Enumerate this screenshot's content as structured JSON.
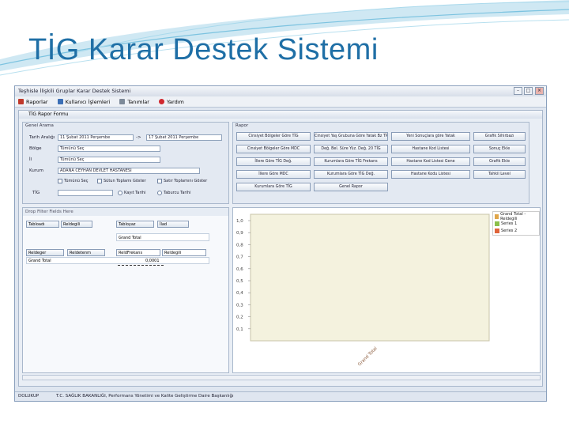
{
  "slide": {
    "title": "TİG Karar Destek Sistemi"
  },
  "window": {
    "title": "Teşhisle İlişkili Gruplar Karar Destek Sistemi",
    "menu": [
      {
        "label": "Raporlar",
        "icon": "report-icon",
        "color": "#c0392b"
      },
      {
        "label": "Kullanıcı İşlemleri",
        "icon": "users-icon",
        "color": "#3b6fb6"
      },
      {
        "label": "Tanımlar",
        "icon": "settings-icon",
        "color": "#7d8a99"
      },
      {
        "label": "Yardım",
        "icon": "heart-icon",
        "color": "#d0282f"
      }
    ]
  },
  "form": {
    "title": "TİG Rapor Formu",
    "filter_group": "Genel Arama",
    "date_label": "Tarih Aralığı",
    "date_from": "11  Şubat  2011 Perşembe",
    "date_sep": "->",
    "date_to": "17  Şubat  2011 Perşembe",
    "region_label": "Bölge",
    "region_value": "Tümünü Seç",
    "city_label": "İl",
    "city_value": "Tümünü Seç",
    "institution_label": "Kurum",
    "institution_value": "ADANA CEYHAN DEVLET HASTANESİ",
    "select_all": "Tümünü Seç",
    "col_total": "Sütun Toplamı Göster",
    "row_total": "Satır Toplamını Göster",
    "tig_label": "TİG",
    "radio_admit": "Kayıt Tarihi",
    "radio_exit": "Taburcu Tarihi"
  },
  "reports": {
    "group": "Rapor",
    "buttons": [
      "Cinsiyet Bölgeler Göre TİG",
      "Cinsiyet Yaş Grubuna Göre Yatak Bz TİG",
      "Yeni Sonuçlara göre Yatak",
      "Grafik Sihirbazı",
      "Cinsiyet Bölgeler Göre MDC",
      "Değ. Bel. Süre Yüz. Değ. 20 TİG",
      "Hastane Kod Listesi",
      "Sonuç Ekle",
      "İllere Göre TİG Değ.",
      "Kurumlara Göre TİG Frekans",
      "Hastane Kod Listesi Gene",
      "Grafik Ekle",
      "İllere Göre MDC",
      "Kurumlara Göre TİG Değ.",
      "Hastane Kodu Listesi",
      "Tahkil Level",
      "Kurumlara Göre TİG",
      "Genel Rapor"
    ]
  },
  "pivot": {
    "drop_header": "Drop Filter Fields Here",
    "filters": [
      "Tabloadı",
      "Reldegili"
    ],
    "col_fields": [
      "Tabloyaz",
      "İlad"
    ],
    "grand_total": "Grand Total",
    "row_fields": [
      "Reldeger",
      "Reldetenm"
    ],
    "data_fields": [
      "ReldFrekans",
      "Reldegili"
    ],
    "row_label": "Grand Total",
    "row_value": "0,0001"
  },
  "chart_data": {
    "type": "bar",
    "categories": [
      "Grand Total"
    ],
    "series": [
      {
        "name": "Grand Total - Reldegili",
        "values": [
          0
        ],
        "color": "#e0a64a"
      },
      {
        "name": "Series 1",
        "values": [
          0
        ],
        "color": "#8cbf4a"
      },
      {
        "name": "Series 2",
        "values": [
          0
        ],
        "color": "#e0643a"
      }
    ],
    "yticks": [
      "1,0",
      "0,9",
      "0,8",
      "0,7",
      "0,6",
      "0,5",
      "0,4",
      "0,3",
      "0,2",
      "0,1"
    ],
    "xlabel_rot": "Grand Total",
    "legend_position": "top-right"
  },
  "status": {
    "left": "DOLUKUP",
    "text": "T.C. SAĞLIK BAKANLIĞI, Performans Yönetimi ve Kalite Geliştirme Daire Başkanlığı"
  }
}
